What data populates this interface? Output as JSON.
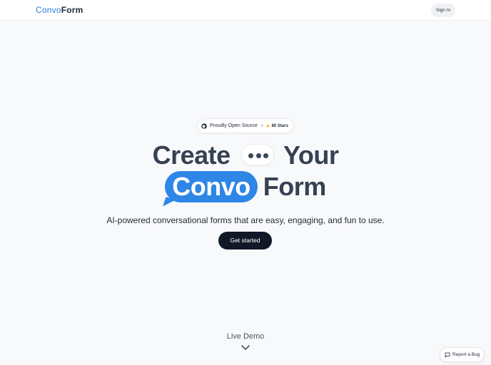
{
  "header": {
    "logo_part1": "Convo",
    "logo_part2": "Form",
    "signin_label": "Sign In"
  },
  "badge": {
    "label": "Proudly Open Source",
    "stars": "80 Stars"
  },
  "hero": {
    "line1_word1": "Create",
    "line1_word2": "Your",
    "line2_word1": "Convo",
    "line2_word2": "Form",
    "subtitle": "AI-powered conversational forms that are easy, engaging, and fun to use.",
    "cta_label": "Get started"
  },
  "demo": {
    "label": "Live Demo"
  },
  "report": {
    "label": "Report a Bug"
  },
  "colors": {
    "accent": "#2e86e6",
    "cta": "#111827",
    "background": "#f8f9fb"
  }
}
